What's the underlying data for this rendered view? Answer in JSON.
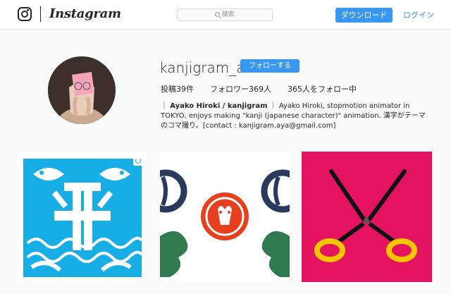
{
  "header": {
    "brand": "Instagram",
    "search_placeholder": "検索",
    "download_label": "ダウンロード",
    "login_label": "ログイン"
  },
  "profile": {
    "username": "kanjigram_a",
    "follow_label": "フォローする",
    "stats": {
      "posts": "投稿39件",
      "followers": "フォロワー369人",
      "following": "365人をフォロー中"
    },
    "bio_prefix": "｜",
    "bio_name": "Ayako Hiroki / kanjigram",
    "bio_text": "｜ Ayako Hiroki, stopmotion animator in TOKYO, enjoys making \"kanji (japanese character)\" animation. 漢字がテーマのコマ撮り。[contact : kanjigram.aya@gmail.com]"
  },
  "colors": {
    "accent": "#3897f0",
    "cyan_papercut": "#17aee6",
    "navy": "#2a3a5c",
    "green": "#2f7a4f",
    "red": "#e8401f",
    "magenta": "#e4135f",
    "scissor_yellow": "#f6c400"
  },
  "icons": {
    "logo": "instagram-glyph-icon",
    "search": "search-icon",
    "multi_post": "multi-post-icon"
  }
}
